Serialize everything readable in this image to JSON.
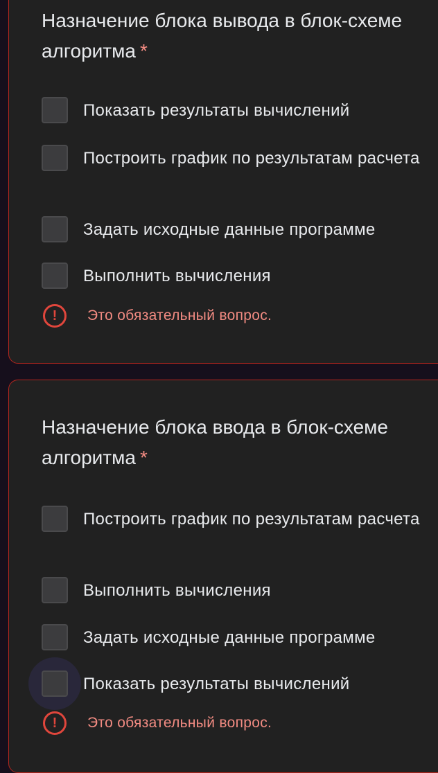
{
  "questions": [
    {
      "title": "Назначение блока вывода в блок-схеме алгоритма",
      "required_mark": "*",
      "options": [
        "Показать результаты вычислений",
        "Построить график по результатам расчета",
        "Задать исходные данные программе",
        "Выполнить вычисления"
      ],
      "error": "Это обязательный вопрос."
    },
    {
      "title": "Назначение блока ввода в блок-схеме алгоритма",
      "required_mark": "*",
      "options": [
        "Построить график по результатам расчета",
        "Выполнить вычисления",
        "Задать исходные данные программе",
        "Показать результаты вычислений"
      ],
      "error": "Это обязательный вопрос."
    }
  ],
  "icons": {
    "error": "error-exclamation-icon",
    "checkbox": "checkbox-unchecked"
  },
  "colors": {
    "background": "#160f1c",
    "card": "#212121",
    "card_border": "#b3261e",
    "text": "#e8eaed",
    "error": "#f28b82",
    "error_icon": "#e0463c",
    "checkbox": "#3c3c3e"
  }
}
